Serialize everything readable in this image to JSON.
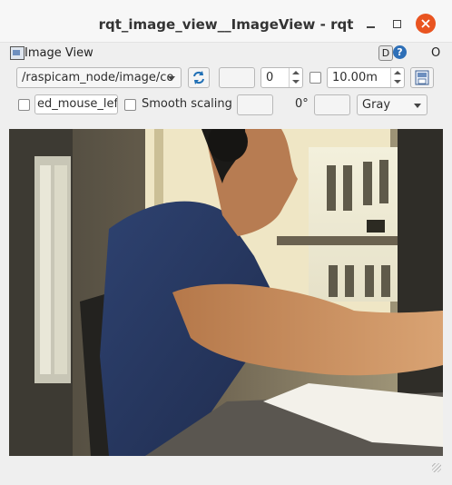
{
  "window": {
    "title": "rqt_image_view__ImageView - rqt"
  },
  "dock": {
    "title": "Image View",
    "d_label": "D",
    "help_label": "?",
    "o_label": "O"
  },
  "toolbar1": {
    "topic": "/raspicam_node/image/co",
    "refresh_icon": "refresh-icon",
    "number_value": "0",
    "rate_value": "10.00m",
    "save_icon": "save-icon"
  },
  "toolbar2": {
    "mouse_topic": "ed_mouse_left",
    "smooth_label": "Smooth scaling",
    "rotation": "0°",
    "color_scheme": "Gray"
  },
  "image": {
    "description_icon": "camera-image"
  },
  "colors": {
    "close_button": "#e95420",
    "window_bg": "#efefef"
  }
}
